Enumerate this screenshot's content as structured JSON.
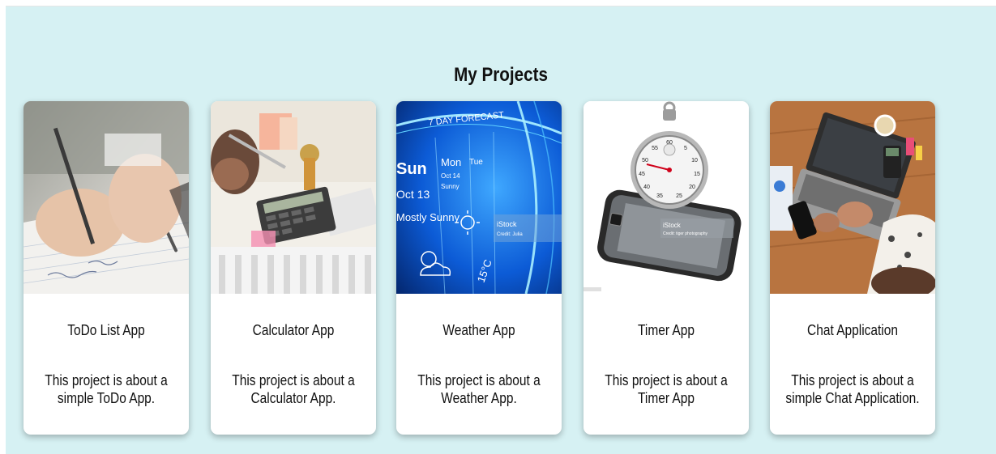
{
  "section": {
    "title": "My Projects"
  },
  "projects": [
    {
      "title": "ToDo List App",
      "description": "This project is about a simple ToDo App.",
      "image_icon": "writing-notebook-photo"
    },
    {
      "title": "Calculator App",
      "description": "This project is about a Calculator App.",
      "image_icon": "calculator-photo"
    },
    {
      "title": "Weather App",
      "description": "This project is about a Weather App.",
      "image_icon": "weather-forecast-photo",
      "image_text": {
        "banner": "7 DAY FORECAST",
        "day1": "Sun",
        "date1": "Oct 13",
        "cond1": "Mostly Sunny",
        "day2": "Mon",
        "date2": "Oct 14",
        "cond2": "Sunny",
        "day3": "Tue",
        "temp": "15°C",
        "watermark": "iStock",
        "credit": "Credit: Julia"
      }
    },
    {
      "title": "Timer App",
      "description": "This project is about a Timer App",
      "image_icon": "stopwatch-phone-photo",
      "image_text": {
        "watermark": "iStock",
        "credit": "Credit: tiger photography"
      }
    },
    {
      "title": "Chat Application",
      "description": "This project is about a simple Chat Application.",
      "image_icon": "laptop-desk-photo"
    }
  ],
  "colors": {
    "background": "#d6f1f3",
    "card": "#ffffff",
    "text": "#111111"
  }
}
